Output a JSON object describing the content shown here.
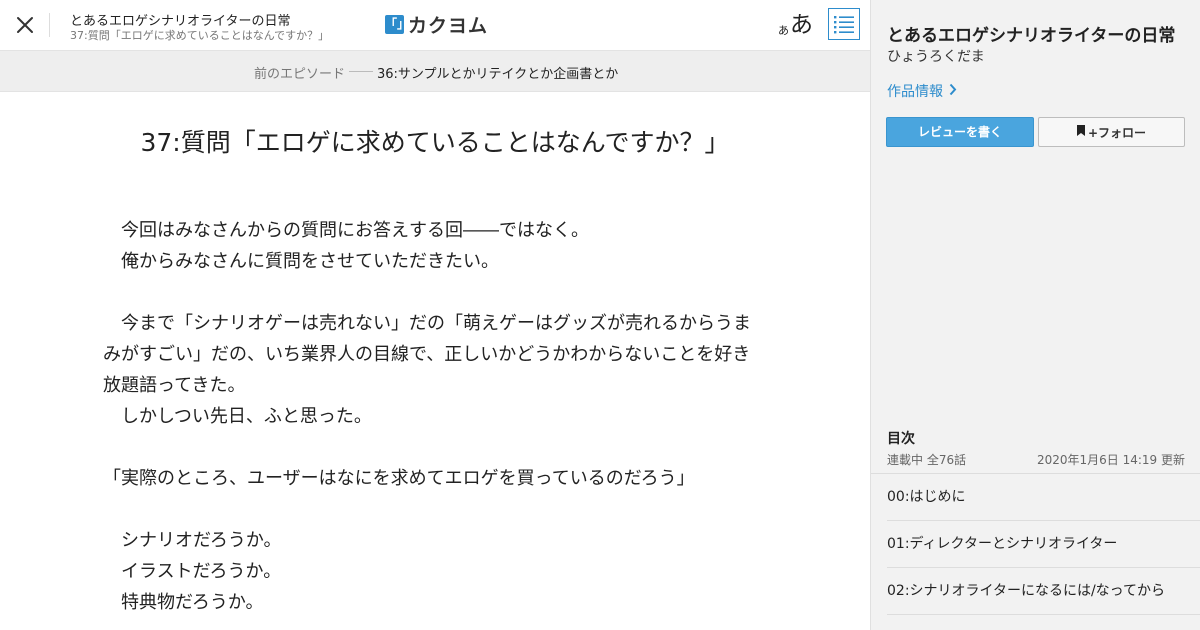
{
  "header": {
    "work_title": "とあるエロゲシナリオライターの日常",
    "episode_title": "37:質問「エロゲに求めていることはなんですか？」",
    "logo_mark": "「」",
    "logo_text": "カクヨム",
    "font_size_small": "あ",
    "font_size_large": "あ",
    "icons": {
      "close": "close-icon",
      "toc": "list-icon"
    },
    "accent_color": "#2d8ccc"
  },
  "prev_episode": {
    "label": "前のエピソード",
    "title": "36:サンプルとかリテイクとか企画書とか"
  },
  "episode": {
    "heading": "37:質問「エロゲに求めていることはなんですか？」",
    "paragraphs": [
      "　今回はみなさんからの質問にお答えする回――ではなく。",
      "　俺からみなさんに質問をさせていただきたい。",
      "",
      "　今まで「シナリオゲーは売れない」だの「萌えゲーはグッズが売れるからうまみがすごい」だの、いち業界人の目線で、正しいかどうかわからないことを好き放題語ってきた。",
      "　しかしつい先日、ふと思った。",
      "",
      "「実際のところ、ユーザーはなにを求めてエロゲを買っているのだろう」",
      "",
      "　シナリオだろうか。",
      "　イラストだろうか。",
      "　特典物だろうか。"
    ]
  },
  "sidebar": {
    "work_title": "とあるエロゲシナリオライターの日常",
    "author": "ひょうろくだま",
    "info_link": "作品情報",
    "review_button": "レビューを書く",
    "follow_button": "+フォロー",
    "review_button_color": "#4aa5de",
    "toc": {
      "heading": "目次",
      "status": "連載中 全76話",
      "updated": "2020年1月6日 14:19 更新",
      "items": [
        "00:はじめに",
        "01:ディレクターとシナリオライター",
        "02:シナリオライターになるには/なってから"
      ]
    }
  }
}
